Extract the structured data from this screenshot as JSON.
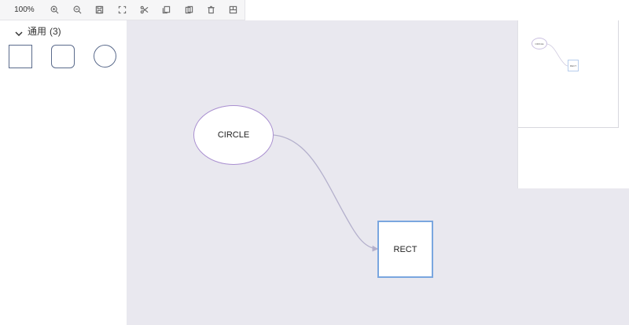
{
  "toolbar": {
    "zoom_label": "100%",
    "tools": [
      {
        "name": "zoom-in-icon"
      },
      {
        "name": "zoom-out-icon"
      },
      {
        "name": "save-icon"
      },
      {
        "name": "fit-view-icon"
      },
      {
        "name": "cut-icon"
      },
      {
        "name": "copy-icon"
      },
      {
        "name": "paste-icon"
      },
      {
        "name": "delete-icon"
      },
      {
        "name": "layout-icon"
      }
    ]
  },
  "sidebar": {
    "group": {
      "title": "通用",
      "count": "(3)",
      "shapes": [
        {
          "name": "rect-shape"
        },
        {
          "name": "rounded-rect-shape"
        },
        {
          "name": "circle-shape"
        }
      ]
    }
  },
  "canvas": {
    "nodes": [
      {
        "id": "circle",
        "label": "CIRCLE",
        "shape": "ellipse"
      },
      {
        "id": "rect",
        "label": "RECT",
        "shape": "rect"
      }
    ],
    "edges": [
      {
        "from": "circle",
        "to": "rect"
      }
    ]
  },
  "minimap": {
    "circle_label": "CIRCLE",
    "rect_label": "RECT"
  },
  "colors": {
    "canvas_bg": "#e9e8ef",
    "circle_border": "#a98fd0",
    "rect_border": "#7aa6df",
    "edge": "#b4b0cc",
    "shape_stroke": "#5b6b8c"
  }
}
